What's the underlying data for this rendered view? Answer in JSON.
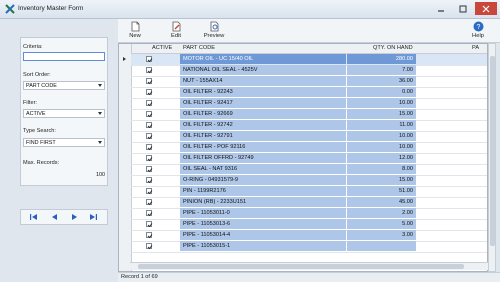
{
  "window": {
    "title": "Inventory Master Form"
  },
  "toolbar": {
    "new": "New",
    "edit": "Edit",
    "preview": "Preview",
    "help": "Help"
  },
  "filters": {
    "criteria_label": "Criteria:",
    "criteria_value": "",
    "sort_label": "Sort Order:",
    "sort_value": "PART CODE",
    "filter_label": "Filter:",
    "filter_value": "ACTIVE",
    "type_search_label": "Type Search:",
    "type_search_value": "FIND FIRST",
    "max_records_label": "Max. Records:",
    "max_records_value": "100"
  },
  "grid": {
    "headers": {
      "active": "ACTIVE",
      "part_code": "PART CODE",
      "qty": "QTY. ON HAND",
      "next": "PA"
    },
    "rows": [
      {
        "part_code": "MOTOR OIL - UC 15/40 OIL",
        "qty": "280.00"
      },
      {
        "part_code": "NATIONAL OIL SEAL - 4525V",
        "qty": "7.00"
      },
      {
        "part_code": "NUT - 155AX14",
        "qty": "36.00"
      },
      {
        "part_code": "OIL FILTER - 92243",
        "qty": "0.00"
      },
      {
        "part_code": "OIL FILTER - 92417",
        "qty": "10.00"
      },
      {
        "part_code": "OIL FILTER - 92669",
        "qty": "15.00"
      },
      {
        "part_code": "OIL FILTER - 92742",
        "qty": "11.00"
      },
      {
        "part_code": "OIL FILTER - 92791",
        "qty": "10.00"
      },
      {
        "part_code": "OIL FILTER - POF 92116",
        "qty": "10.00"
      },
      {
        "part_code": "OIL FILTER OFFRD - 92749",
        "qty": "12.00"
      },
      {
        "part_code": "OIL SEAL - NAT 9316",
        "qty": "8.00"
      },
      {
        "part_code": "O-RING - 04931579-9",
        "qty": "15.00"
      },
      {
        "part_code": "PIN - 1199R2176",
        "qty": "51.00"
      },
      {
        "part_code": "PINION (RB) - 2233U151",
        "qty": "45.00"
      },
      {
        "part_code": "PIPE - 11053011-0",
        "qty": "2.00"
      },
      {
        "part_code": "PIPE - 11053013-6",
        "qty": "5.00"
      },
      {
        "part_code": "PIPE - 11053014-4",
        "qty": "3.00"
      },
      {
        "part_code": "PIPE - 11053015-1",
        "qty": ""
      }
    ]
  },
  "status": {
    "record": "Record 1 of 69"
  },
  "colors": {
    "accent": "#6f99d6",
    "row_highlight": "#aec6e8",
    "close": "#c9463d"
  }
}
